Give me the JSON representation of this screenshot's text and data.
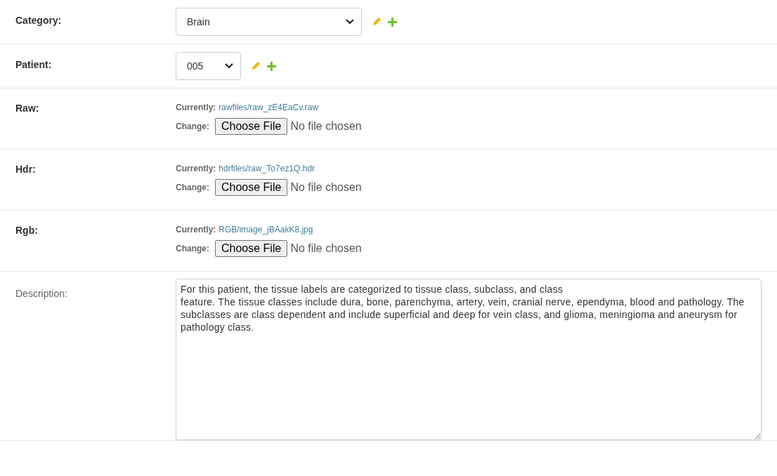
{
  "rows": [
    {
      "kind": "select",
      "label": "Category:",
      "required": true,
      "value": "Brain",
      "wide": true
    },
    {
      "kind": "select",
      "label": "Patient:",
      "required": true,
      "value": "005",
      "wide": false
    },
    {
      "kind": "file",
      "label": "Raw:",
      "required": true,
      "currently_label": "Currently:",
      "current_file": "rawfiles/raw_zE4EaCv.raw",
      "change_label": "Change:",
      "button": "Choose File",
      "status": "No file chosen"
    },
    {
      "kind": "file",
      "label": "Hdr:",
      "required": true,
      "currently_label": "Currently:",
      "current_file": "hdrfiles/raw_To7ez1Q.hdr",
      "change_label": "Change:",
      "button": "Choose File",
      "status": "No file chosen"
    },
    {
      "kind": "file",
      "label": "Rgb:",
      "required": true,
      "currently_label": "Currently:",
      "current_file": "RGB/image_jBAakK8.jpg",
      "change_label": "Change:",
      "button": "Choose File",
      "status": "No file chosen"
    },
    {
      "kind": "textarea",
      "label": "Description:",
      "required": false,
      "value": "For this patient, the tissue labels are categorized to tissue class, subclass, and class\nfeature. The tissue classes include dura, bone, parenchyma, artery, vein, cranial nerve, ependyma, blood and pathology. The subclasses are class dependent and include superficial and deep for vein class, and glioma, meningioma and aneurysm for pathology class."
    }
  ]
}
